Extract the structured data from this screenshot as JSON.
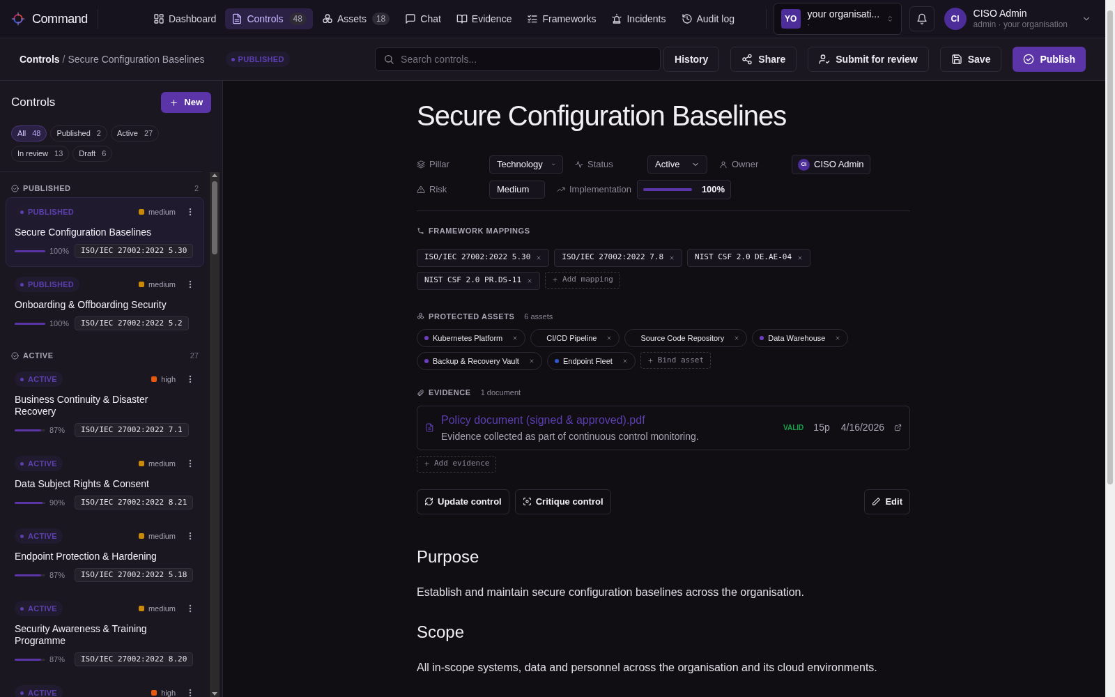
{
  "app": {
    "name": "Command"
  },
  "nav": [
    {
      "label": "Dashboard",
      "selected": false
    },
    {
      "label": "Controls",
      "count": "48",
      "selected": true
    },
    {
      "label": "Assets",
      "count": "18",
      "selected": false
    },
    {
      "label": "Chat",
      "selected": false
    },
    {
      "label": "Evidence",
      "selected": false
    },
    {
      "label": "Frameworks",
      "selected": false
    },
    {
      "label": "Incidents",
      "selected": false
    },
    {
      "label": "Audit log",
      "selected": false
    }
  ],
  "org": {
    "initials": "YO",
    "name": "your organisati...",
    "subtitle": "·"
  },
  "user": {
    "initials": "CI",
    "name": "CISO Admin",
    "subtitle": "admin · your organisation"
  },
  "breadcrumb": {
    "root": "Controls",
    "separator": "/",
    "current": "Secure Configuration Baselines"
  },
  "status_badge": "PUBLISHED",
  "search": {
    "placeholder": "Search controls..."
  },
  "actions": [
    {
      "label": "History",
      "kind": "plain"
    },
    {
      "label": "Share",
      "kind": "secondary"
    },
    {
      "label": "Submit for review",
      "kind": "secondary"
    },
    {
      "label": "Save",
      "kind": "secondary"
    },
    {
      "label": "Publish",
      "kind": "primary"
    }
  ],
  "sidebar": {
    "title": "Controls",
    "new_button": "New",
    "filters": [
      {
        "label": "All",
        "count": "48",
        "selected": true
      },
      {
        "label": "Published",
        "count": "2",
        "selected": false
      },
      {
        "label": "Active",
        "count": "27",
        "selected": false
      },
      {
        "label": "In review",
        "count": "13",
        "selected": false
      },
      {
        "label": "Draft",
        "count": "6",
        "selected": false
      }
    ],
    "groups": [
      {
        "label": "PUBLISHED",
        "count": "2",
        "items": [
          {
            "status": "PUBLISHED",
            "risk": "medium",
            "color": "#ca8a04",
            "title": "Secure Configuration Baselines",
            "level": 1,
            "percent": "100%",
            "framework": "ISO/IEC 27002:2022 5.30",
            "selected": true
          },
          {
            "status": "PUBLISHED",
            "risk": "medium",
            "color": "#ca8a04",
            "title": "Onboarding & Offboarding Security",
            "level": 1,
            "percent": "100%",
            "framework": "ISO/IEC 27002:2022 5.2",
            "selected": false
          }
        ]
      },
      {
        "label": "ACTIVE",
        "count": "27",
        "items": [
          {
            "status": "ACTIVE",
            "risk": "high",
            "color": "#ea580c",
            "title": "Business Continuity & Disaster Recovery",
            "level": 0.87,
            "percent": "87%",
            "framework": "ISO/IEC 27002:2022 7.1",
            "selected": false
          },
          {
            "status": "ACTIVE",
            "risk": "medium",
            "color": "#ca8a04",
            "title": "Data Subject Rights & Consent",
            "level": 0.9,
            "percent": "90%",
            "framework": "ISO/IEC 27002:2022 8.21",
            "selected": false
          },
          {
            "status": "ACTIVE",
            "risk": "medium",
            "color": "#ca8a04",
            "title": "Endpoint Protection & Hardening",
            "level": 0.87,
            "percent": "87%",
            "framework": "ISO/IEC 27002:2022 5.18",
            "selected": false
          },
          {
            "status": "ACTIVE",
            "risk": "medium",
            "color": "#ca8a04",
            "title": "Security Awareness & Training Programme",
            "level": 0.87,
            "percent": "87%",
            "framework": "ISO/IEC 27002:2022 8.20",
            "selected": false
          },
          {
            "status": "ACTIVE",
            "risk": "high",
            "color": "#ea580c",
            "selected": false
          }
        ]
      }
    ]
  },
  "control": {
    "title": "Secure Configuration Baselines",
    "fields": [
      {
        "label": "Pillar",
        "kind": "select",
        "value": "Technology"
      },
      {
        "label": "Status",
        "kind": "select",
        "value": "Active"
      },
      {
        "label": "Owner",
        "kind": "person",
        "initials": "CI",
        "value": "CISO Admin"
      },
      {
        "label": "Risk",
        "kind": "select",
        "value": "Medium"
      },
      {
        "label": "Implementation",
        "kind": "progress",
        "level": 1,
        "value": "100%"
      }
    ],
    "mappings": {
      "label": "FRAMEWORK MAPPINGS",
      "items": [
        "ISO/IEC 27002:2022 5.30",
        "ISO/IEC 27002:2022 7.8",
        "NIST CSF 2.0 DE.AE-04",
        "NIST CSF 2.0 PR.DS-11"
      ],
      "add": "Add mapping"
    },
    "assets": {
      "label": "PROTECTED ASSETS",
      "count": "6 assets",
      "items": [
        {
          "name": "Kubernetes Platform",
          "color": "#6d3fc0"
        },
        {
          "name": "CI/CD Pipeline"
        },
        {
          "name": "Source Code Repository"
        },
        {
          "name": "Data Warehouse",
          "color": "#6d3fc0"
        },
        {
          "name": "Backup & Recovery Vault",
          "color": "#6d3fc0"
        },
        {
          "name": "Endpoint Fleet",
          "color": "#2f55c8"
        }
      ],
      "add": "Bind asset"
    },
    "evidence": {
      "label": "EVIDENCE",
      "count": "1 document",
      "items": [
        {
          "title": "Policy document (signed & approved).pdf",
          "description": "Evidence collected as part of continuous control monitoring.",
          "status": "VALID",
          "pages": "15p",
          "date": "4/16/2026"
        }
      ],
      "add": "Add evidence"
    },
    "buttons": [
      "Update control",
      "Critique control"
    ],
    "edit": "Edit",
    "sections": [
      {
        "heading": "Purpose",
        "body": "Establish and maintain secure configuration baselines across the organisation."
      },
      {
        "heading": "Scope",
        "body": "All in-scope systems, data and personnel across the organisation and its cloud environments."
      }
    ]
  }
}
